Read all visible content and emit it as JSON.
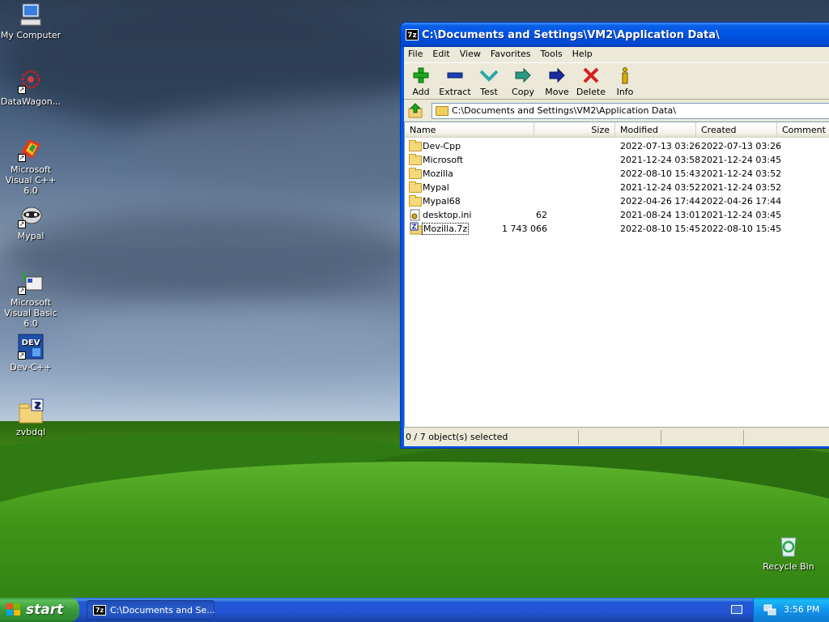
{
  "desktop": {
    "icons": [
      {
        "label": "My Computer"
      },
      {
        "label": "DataWagon..."
      },
      {
        "label": "Microsoft Visual C++ 6.0"
      },
      {
        "label": "Mypal"
      },
      {
        "label": "Microsoft Visual Basic 6.0"
      },
      {
        "label": "Dev-C++"
      },
      {
        "label": "zvbdql"
      },
      {
        "label": "Recycle Bin"
      }
    ]
  },
  "window": {
    "title": "C:\\Documents and Settings\\VM2\\Application Data\\",
    "title_icon": "7z",
    "menu": [
      "File",
      "Edit",
      "View",
      "Favorites",
      "Tools",
      "Help"
    ],
    "toolbar": [
      {
        "label": "Add",
        "icon": "plus-icon",
        "color": "#1ea61e"
      },
      {
        "label": "Extract",
        "icon": "minus-icon",
        "color": "#1c3fb5"
      },
      {
        "label": "Test",
        "icon": "check-icon",
        "color": "#2aa8a8"
      },
      {
        "label": "Copy",
        "icon": "copy-arrow-icon",
        "color": "#2a9a80"
      },
      {
        "label": "Move",
        "icon": "move-arrow-icon",
        "color": "#1a2d9c"
      },
      {
        "label": "Delete",
        "icon": "delete-x-icon",
        "color": "#d81e1e"
      },
      {
        "label": "Info",
        "icon": "info-icon",
        "color": "#d8b000"
      }
    ],
    "address": "C:\\Documents and Settings\\VM2\\Application Data\\",
    "columns": [
      "Name",
      "Size",
      "Modified",
      "Created",
      "Comment"
    ],
    "rows": [
      {
        "name": "Dev-Cpp",
        "size": "",
        "modified": "2022-07-13 03:26",
        "created": "2022-07-13 03:26",
        "type": "folder"
      },
      {
        "name": "Microsoft",
        "size": "",
        "modified": "2021-12-24 03:58",
        "created": "2021-12-24 03:45",
        "type": "folder"
      },
      {
        "name": "Mozilla",
        "size": "",
        "modified": "2022-08-10 15:43",
        "created": "2021-12-24 03:52",
        "type": "folder"
      },
      {
        "name": "Mypal",
        "size": "",
        "modified": "2021-12-24 03:52",
        "created": "2021-12-24 03:52",
        "type": "folder"
      },
      {
        "name": "Mypal68",
        "size": "",
        "modified": "2022-04-26 17:44",
        "created": "2022-04-26 17:44",
        "type": "folder"
      },
      {
        "name": "desktop.ini",
        "size": "62",
        "modified": "2021-08-24 13:01",
        "created": "2021-12-24 03:45",
        "type": "ini"
      },
      {
        "name": "Mozilla.7z",
        "size": "1 743 066",
        "modified": "2022-08-10 15:45",
        "created": "2022-08-10 15:45",
        "type": "archive"
      }
    ],
    "status": "0 / 7 object(s) selected"
  },
  "taskbar": {
    "start_label": "start",
    "task_label": "C:\\Documents and Se...",
    "task_icon": "7z",
    "clock": "3:56 PM"
  }
}
